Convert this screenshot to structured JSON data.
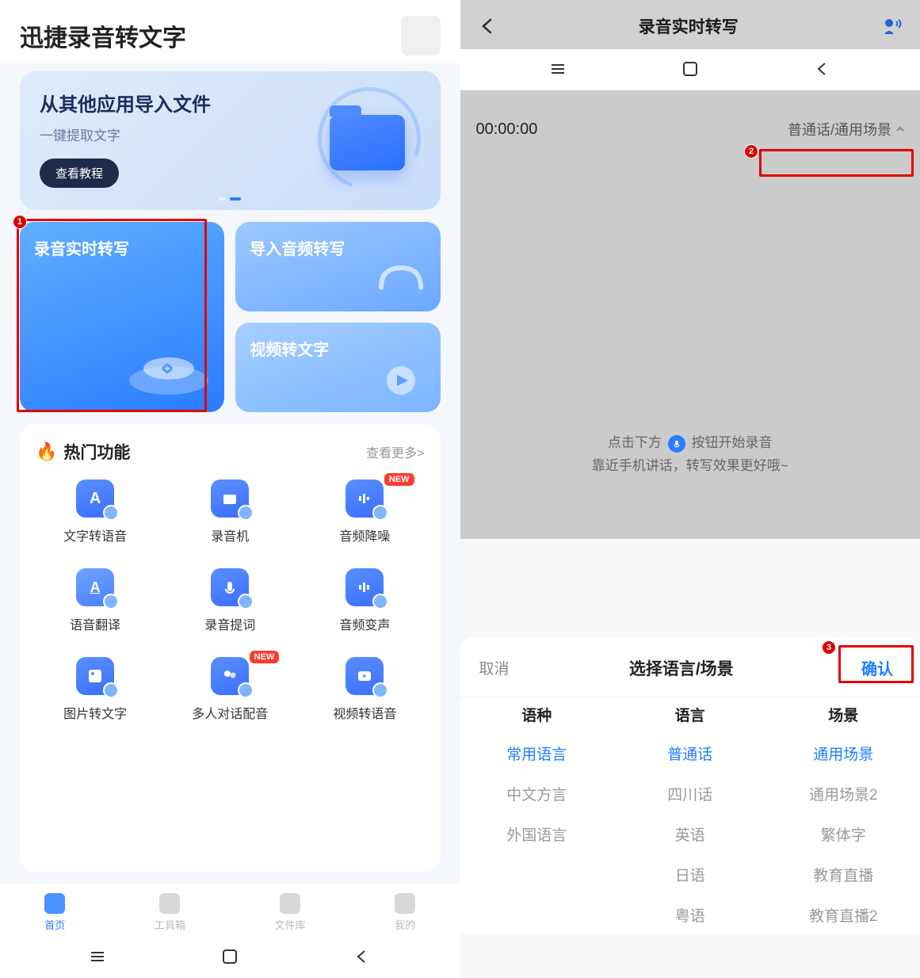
{
  "left": {
    "app_title": "迅捷录音转文字",
    "banner": {
      "title": "从其他应用导入文件",
      "subtitle": "一键提取文字",
      "button": "查看教程"
    },
    "features": {
      "realtime": "录音实时转写",
      "import": "导入音频转写",
      "video": "视频转文字"
    },
    "hot": {
      "title": "热门功能",
      "more": "查看更多>",
      "items": [
        {
          "label": "文字转语音",
          "new": false
        },
        {
          "label": "录音机",
          "new": false
        },
        {
          "label": "音频降噪",
          "new": true
        },
        {
          "label": "语音翻译",
          "new": false
        },
        {
          "label": "录音提词",
          "new": false
        },
        {
          "label": "音频变声",
          "new": false
        },
        {
          "label": "图片转文字",
          "new": false
        },
        {
          "label": "多人对话配音",
          "new": true
        },
        {
          "label": "视频转语音",
          "new": false
        }
      ],
      "new_badge": "NEW"
    },
    "tabs": [
      {
        "label": "首页",
        "active": true
      },
      {
        "label": "工具箱",
        "active": false
      },
      {
        "label": "文件库",
        "active": false
      },
      {
        "label": "我的",
        "active": false
      }
    ]
  },
  "right": {
    "title": "录音实时转写",
    "timer": "00:00:00",
    "lang_display": "普通话/通用场景",
    "hint_pre": "点击下方",
    "hint_post": "按钮开始录音",
    "hint2": "靠近手机讲话，转写效果更好哦~",
    "sheet": {
      "cancel": "取消",
      "title": "选择语言/场景",
      "confirm": "确认",
      "tabs": [
        "语种",
        "语言",
        "场景"
      ],
      "col1": [
        "常用语言",
        "中文方言",
        "外国语言"
      ],
      "col2": [
        "普通话",
        "四川话",
        "英语",
        "日语",
        "粤语"
      ],
      "col3": [
        "通用场景",
        "通用场景2",
        "繁体字",
        "教育直播",
        "教育直播2"
      ]
    }
  },
  "annotations": [
    "1",
    "2",
    "3"
  ]
}
